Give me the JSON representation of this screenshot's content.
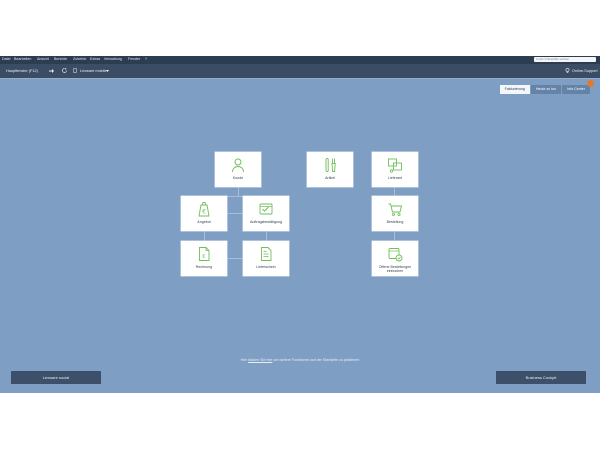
{
  "menu": {
    "items": [
      "Datei",
      "Bearbeiten",
      "Ansicht",
      "Berichte",
      "Zubehör",
      "Extras",
      "Verwaltung",
      "Fenster",
      "?"
    ],
    "search_placeholder": "In der Onlinehilfe suchen"
  },
  "toolbar": {
    "start_label": "Hauptfenster (F12)",
    "view_label": "Lexware mobile",
    "support_label": "Online-Support"
  },
  "tabs": [
    "Fakturierung",
    "Heute zu tun",
    "Info Center"
  ],
  "tiles": {
    "kunde": "Kunde",
    "artikel": "Artikel",
    "lieferant": "Lieferant",
    "angebot": "Angebot",
    "auftragsbestaetigung": "Auftragsbestätigung",
    "bestellung": "Bestellung",
    "rechnung": "Rechnung",
    "lieferschein": "Lieferschein",
    "offene_bestellungen": "Offene Bestellungen einbuchen"
  },
  "hint": {
    "prefix": "Hier ",
    "link": "klicken Sie hier",
    "suffix": " um weitere Funktionen auf der Startseite zu platzieren"
  },
  "buttons": {
    "left": "Lexware social",
    "right": "Business Cockpit"
  },
  "colors": {
    "background": "#7f9ec4",
    "menubar": "#2c3d52",
    "toolbar": "#3a4d64",
    "icon_accent": "#6fbf5a",
    "badge": "#e07a2f"
  }
}
